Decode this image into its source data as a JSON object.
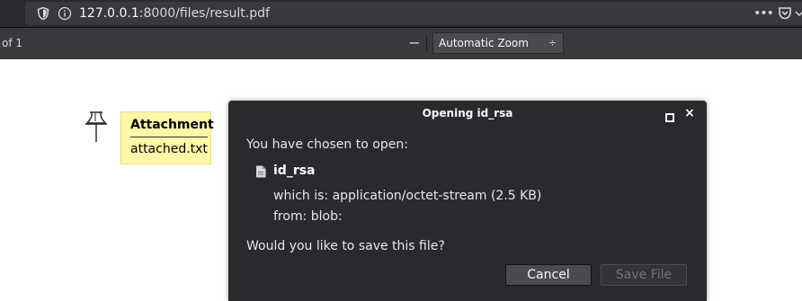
{
  "browser": {
    "url_host": "127.0.0.1",
    "url_rest": ":8000/files/result.pdf",
    "more_label": "•••"
  },
  "pdf_toolbar": {
    "page_of": "of 1",
    "zoom_out_label": "−",
    "zoom_in_label": "+",
    "zoom_value": "Automatic Zoom",
    "zoom_caret": "÷"
  },
  "attachment": {
    "title": "Attachment",
    "filename": "attached.txt"
  },
  "dialog": {
    "title": "Opening id_rsa",
    "close_label": "×",
    "chosen_text": "You have chosen to open:",
    "file_name": "id_rsa",
    "which_is": "which is: application/octet-stream (2.5 KB)",
    "from": "from: blob:",
    "question": "Would you like to save this file?",
    "cancel_label": "Cancel",
    "save_label": "Save File"
  },
  "colors": {
    "toolbar_bg": "#38383d",
    "dialog_bg": "#2a2a2e",
    "note_bg": "#fff8a5"
  },
  "icons": [
    "shield-icon",
    "info-icon",
    "pocket-icon",
    "pushpin-icon",
    "file-icon",
    "maximize-icon",
    "close-icon"
  ]
}
